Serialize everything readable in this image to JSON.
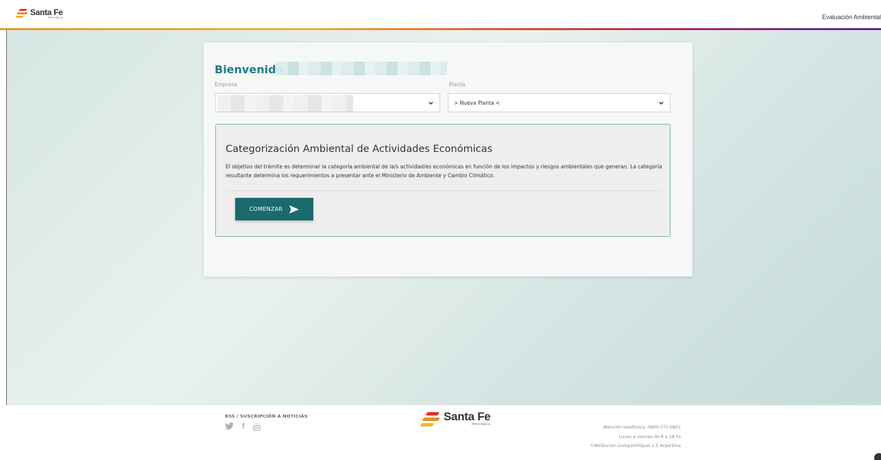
{
  "header": {
    "logo_name": "Santa Fe",
    "logo_sub": "PROVINCIA",
    "link": "Evaluación Ambiental"
  },
  "card": {
    "welcome": "Bienvenido",
    "empresa_label": "Empresa",
    "planta_label": "Planta",
    "planta_value": "> Nueva Planta <",
    "panel": {
      "title": "Categorización Ambiental de Actividades Económicas",
      "description": "El objetivo del trámite es determinar la categoría ambiental de la/s actividad/es económicas en función de los impactos y riesgos ambientales que generan. La categoría resultante determina los requerimientos a presentar ante el Ministerio de Ambiente y Cambio Climático.",
      "button_label": "COMENZAR"
    }
  },
  "footer": {
    "rss": "RSS / SUSCRIPCIÓN A NOTICIAS",
    "social": [
      "twitter-icon",
      "facebook-icon",
      "youtube-icon"
    ],
    "logo_name": "Santa Fe",
    "logo_sub": "PROVINCIA",
    "phone": "Atención telefónica: 0800-777-0801",
    "hours": "Lunes a viernes de 8 a 18 hs",
    "license": "©Atribución-CompartirIgual 2.5 Argentina"
  },
  "colors": {
    "accent": "#1f7d8b",
    "button": "#1a6a6e",
    "panel_border": "#7bb3ad"
  }
}
